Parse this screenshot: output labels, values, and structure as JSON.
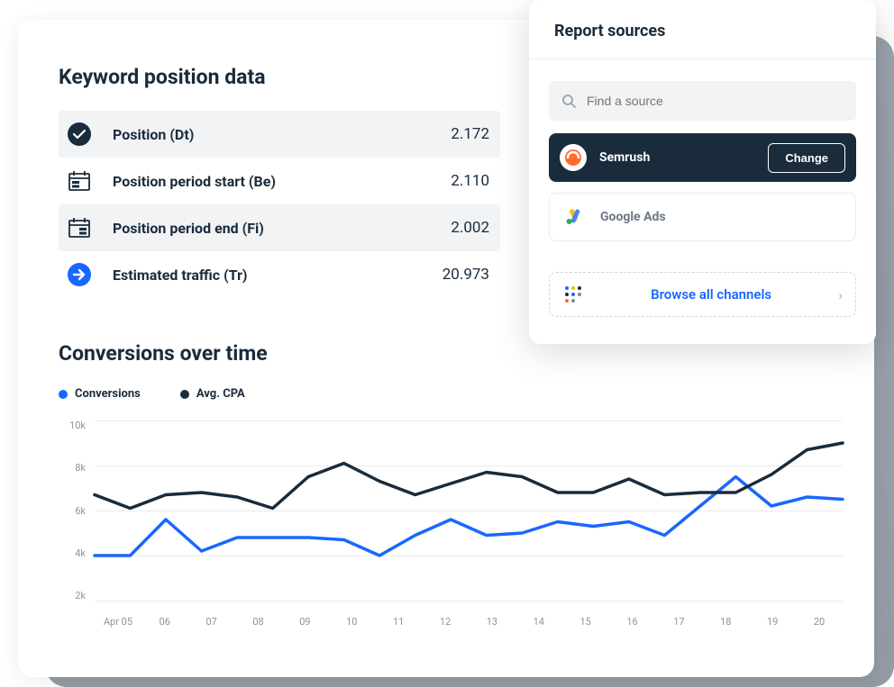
{
  "main": {
    "section1_title": "Keyword position data",
    "section2_title": "Conversions over time",
    "metrics": [
      {
        "label": "Position (Dt)",
        "value": "2.172"
      },
      {
        "label": "Position period start (Be)",
        "value": "2.110"
      },
      {
        "label": "Position period end (Fi)",
        "value": "2.002"
      },
      {
        "label": "Estimated traffic (Tr)",
        "value": "20.973"
      }
    ],
    "legend": {
      "series1": {
        "label": "Conversions",
        "color": "#1967ff"
      },
      "series2": {
        "label": "Avg. CPA",
        "color": "#1a2b3c"
      }
    }
  },
  "sources": {
    "title": "Report sources",
    "search_placeholder": "Find a source",
    "items": {
      "semrush": {
        "name": "Semrush",
        "change_label": "Change"
      },
      "googleads": {
        "name": "Google Ads"
      }
    },
    "browse_label": "Browse all channels"
  },
  "chart_data": {
    "type": "line",
    "title": "Conversions over time",
    "ylim": [
      2000,
      10000
    ],
    "y_ticks": [
      "10k",
      "8k",
      "6k",
      "4k",
      "2k"
    ],
    "categories": [
      "Apr 05",
      "06",
      "07",
      "08",
      "09",
      "10",
      "11",
      "12",
      "13",
      "14",
      "15",
      "16",
      "17",
      "18",
      "19",
      "20"
    ],
    "series": [
      {
        "name": "Conversions",
        "color": "#1967ff",
        "values": [
          4000,
          4000,
          5600,
          4200,
          4800,
          4800,
          4800,
          4700,
          4000,
          4900,
          5600,
          4900,
          5000,
          5500,
          5300,
          5500,
          4900,
          6200,
          7500,
          6200,
          6600,
          6500
        ]
      },
      {
        "name": "Avg. CPA",
        "color": "#1a2b3c",
        "values": [
          6700,
          6100,
          6700,
          6800,
          6600,
          6100,
          7500,
          8100,
          7300,
          6700,
          7200,
          7700,
          7500,
          6800,
          6800,
          7400,
          6700,
          6800,
          6800,
          7600,
          8700,
          9000
        ]
      }
    ]
  }
}
